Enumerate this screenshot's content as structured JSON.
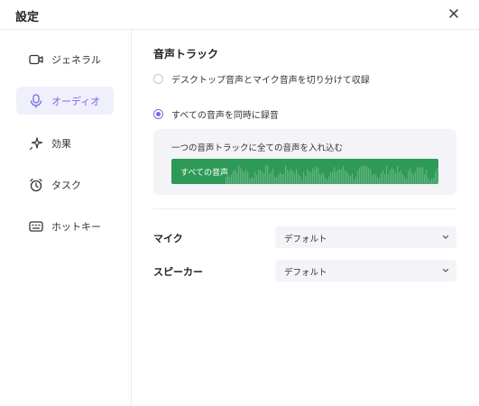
{
  "window": {
    "title": "設定",
    "close_icon": "close-icon"
  },
  "sidebar": {
    "items": [
      {
        "label": "ジェネラル",
        "icon": "camera-icon",
        "active": false
      },
      {
        "label": "オーディオ",
        "icon": "microphone-icon",
        "active": true
      },
      {
        "label": "効果",
        "icon": "sparkle-icon",
        "active": false
      },
      {
        "label": "タスク",
        "icon": "alarm-clock-icon",
        "active": false
      },
      {
        "label": "ホットキー",
        "icon": "keyboard-icon",
        "active": false
      }
    ]
  },
  "audio": {
    "section_title": "音声トラック",
    "options": [
      {
        "label": "デスクトップ音声とマイク音声を切り分けて収録",
        "checked": false
      },
      {
        "label": "すべての音声を同時に録音",
        "checked": true
      }
    ],
    "info_text": "一つの音声トラックに全ての音声を入れ込む",
    "track_label": "すべての音声",
    "fields": [
      {
        "label": "マイク",
        "value": "デフォルト"
      },
      {
        "label": "スピーカー",
        "value": "デフォルト"
      }
    ]
  },
  "colors": {
    "accent": "#7b6ae6",
    "active_bg": "#f0effc",
    "track_green": "#2e9a57",
    "panel_bg": "#f3f3f8"
  }
}
